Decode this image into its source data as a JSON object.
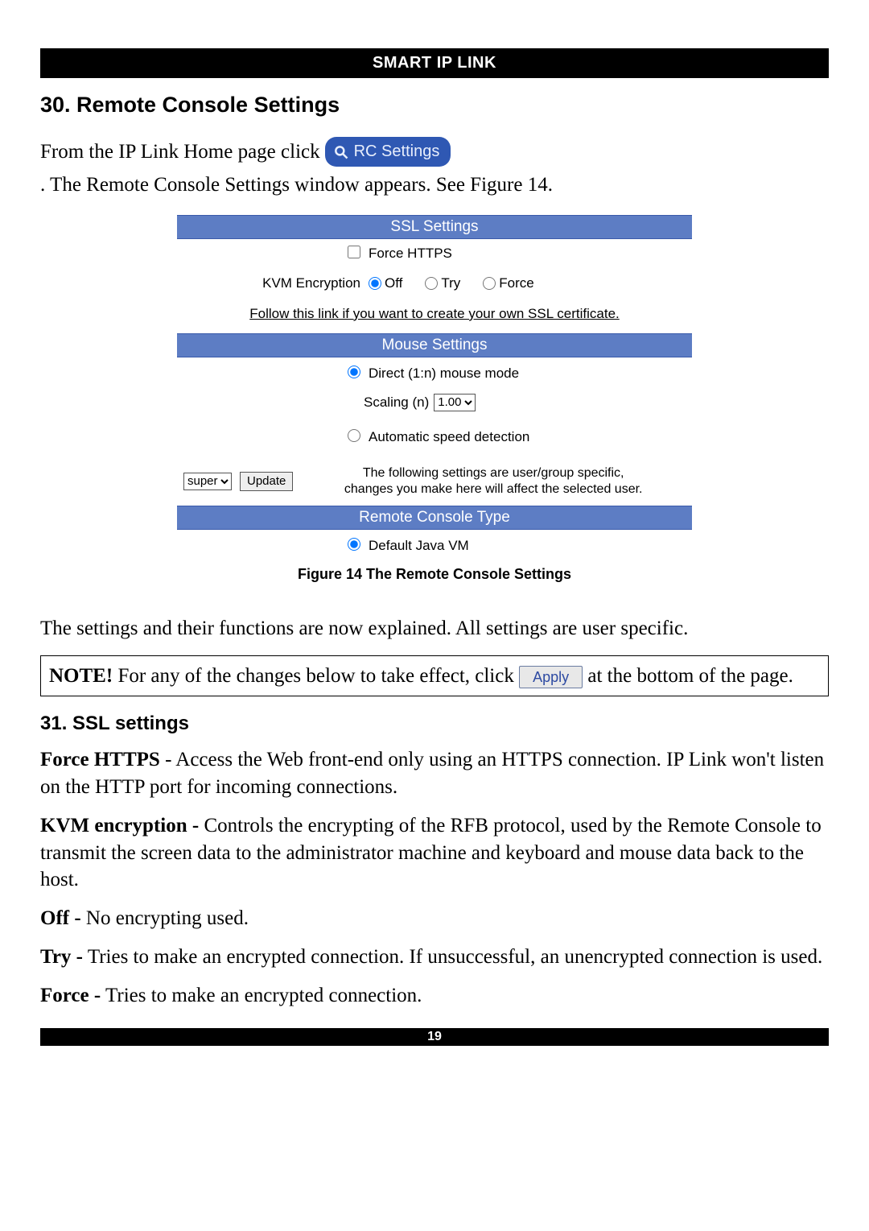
{
  "header": {
    "title": "SMART IP LINK"
  },
  "sections": {
    "s30_title": "30.  Remote Console Settings",
    "s31_title": "31.  SSL settings"
  },
  "intro": {
    "part1": "From the IP Link Home page click ",
    "rc_button_label": "RC Settings",
    "part2": ". The Remote Console Settings window appears. See Figure 14."
  },
  "figure": {
    "ssl": {
      "bar": "SSL Settings",
      "force_https_label": "Force HTTPS",
      "kvm_label": "KVM Encryption",
      "opt_off": "Off",
      "opt_try": "Try",
      "opt_force": "Force",
      "kvm_selected": "Off",
      "link_text": "Follow this link if you want to create your own SSL certificate."
    },
    "mouse": {
      "bar": "Mouse Settings",
      "direct_label": "Direct (1:n) mouse mode",
      "scaling_label": "Scaling (n)",
      "scaling_value": "1.00",
      "auto_label": "Automatic speed detection",
      "mode_selected": "direct"
    },
    "update": {
      "user_value": "super",
      "update_btn": "Update",
      "note_line1": "The following settings are user/group specific,",
      "note_line2": "changes you make here will affect the selected user."
    },
    "rct": {
      "bar": "Remote Console Type",
      "default_label": "Default Java VM"
    },
    "caption": "Figure 14 The Remote Console Settings"
  },
  "explain": "The settings and their functions are now explained. All settings are user specific.",
  "note_box": {
    "bold": "NOTE!",
    "part1": " For any of the changes below to take effect, click ",
    "apply_label": "Apply",
    "part2": " at the bottom of the page."
  },
  "ssl_explain": {
    "force_https_b": "Force HTTPS",
    "force_https_t": " - Access the Web front-end only using an HTTPS connection. IP Link won't listen on the HTTP port for incoming connections.",
    "kvm_b": "KVM encryption -",
    "kvm_t": " Controls the encrypting of the RFB protocol, used by the Remote Console to transmit the screen data to the administrator machine and keyboard and mouse data back to the host.",
    "off_b": "Off -",
    "off_t": " No encrypting used.",
    "try_b": "Try -",
    "try_t": " Tries to make an encrypted connection. If unsuccessful, an unencrypted connection is used.",
    "force_b": "Force -",
    "force_t": " Tries to make an encrypted connection."
  },
  "footer": {
    "page_number": "19"
  }
}
